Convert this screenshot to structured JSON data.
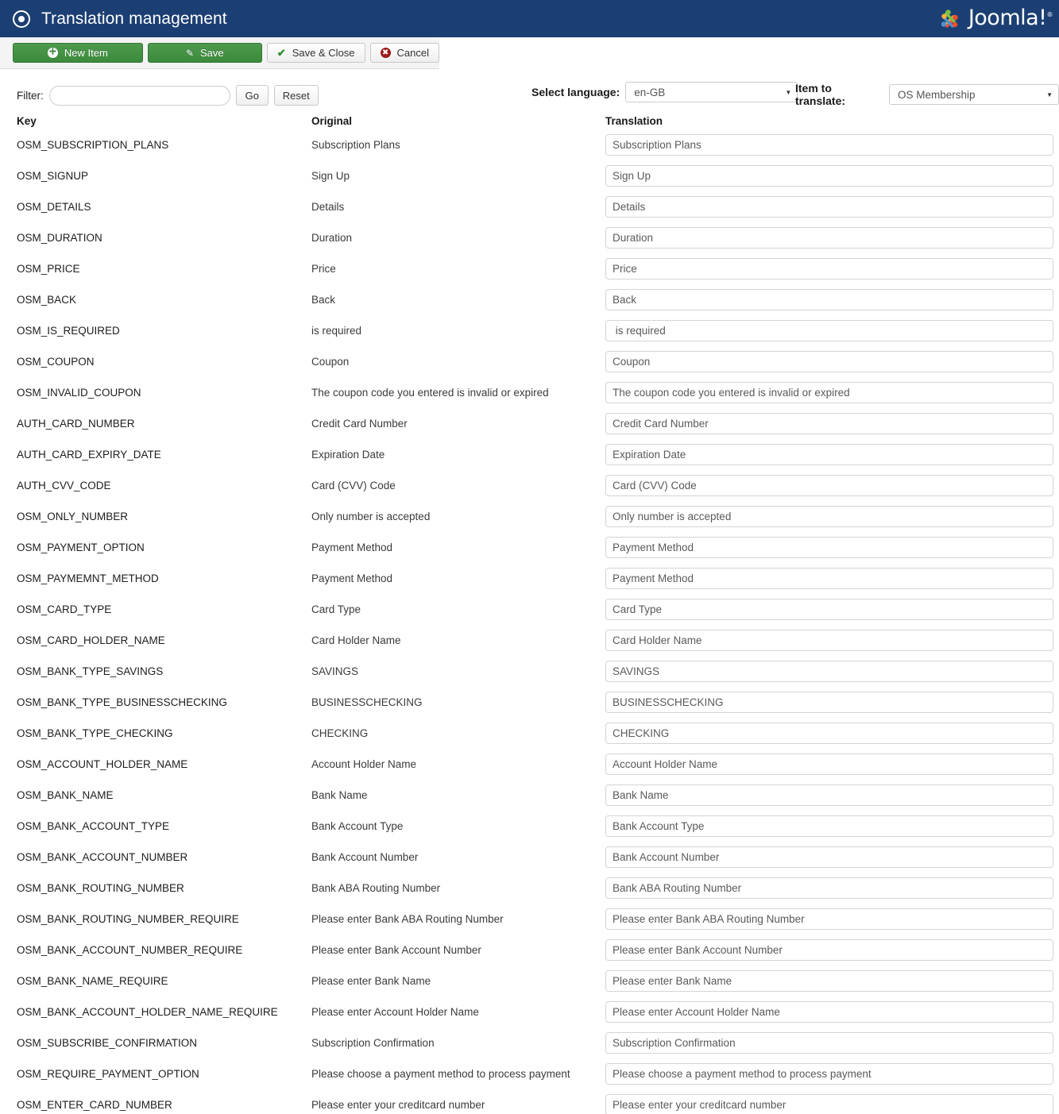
{
  "header": {
    "title": "Translation management",
    "icon": "target-icon",
    "logo_text": "Joomla!",
    "logo_tm": "®",
    "bg_color": "#1c3f73"
  },
  "toolbar": {
    "new_item_label": "New Item",
    "save_label": "Save",
    "save_close_label": "Save & Close",
    "cancel_label": "Cancel",
    "green_color": "#3c8a3c"
  },
  "filter": {
    "label": "Filter:",
    "value": "",
    "placeholder": "",
    "go_label": "Go",
    "reset_label": "Reset"
  },
  "selectors": {
    "language_label": "Select language:",
    "language_value": "en-GB",
    "item_label": "Item to translate:",
    "item_value": "OS Membership"
  },
  "table": {
    "columns": [
      "Key",
      "Original",
      "Translation"
    ],
    "rows": [
      {
        "key": "OSM_SUBSCRIPTION_PLANS",
        "original": "Subscription Plans",
        "translation": "Subscription Plans"
      },
      {
        "key": "OSM_SIGNUP",
        "original": "Sign Up",
        "translation": "Sign Up"
      },
      {
        "key": "OSM_DETAILS",
        "original": "Details",
        "translation": "Details"
      },
      {
        "key": "OSM_DURATION",
        "original": "Duration",
        "translation": "Duration"
      },
      {
        "key": "OSM_PRICE",
        "original": "Price",
        "translation": "Price"
      },
      {
        "key": "OSM_BACK",
        "original": "Back",
        "translation": "Back"
      },
      {
        "key": "OSM_IS_REQUIRED",
        "original": "is required",
        "translation": " is required"
      },
      {
        "key": "OSM_COUPON",
        "original": "Coupon",
        "translation": "Coupon"
      },
      {
        "key": "OSM_INVALID_COUPON",
        "original": "The coupon code you entered is invalid or expired",
        "translation": "The coupon code you entered is invalid or expired"
      },
      {
        "key": "AUTH_CARD_NUMBER",
        "original": "Credit Card Number",
        "translation": "Credit Card Number"
      },
      {
        "key": "AUTH_CARD_EXPIRY_DATE",
        "original": "Expiration Date",
        "translation": "Expiration Date"
      },
      {
        "key": "AUTH_CVV_CODE",
        "original": "Card (CVV) Code",
        "translation": "Card (CVV) Code"
      },
      {
        "key": "OSM_ONLY_NUMBER",
        "original": "Only number is accepted",
        "translation": "Only number is accepted"
      },
      {
        "key": "OSM_PAYMENT_OPTION",
        "original": "Payment Method",
        "translation": "Payment Method"
      },
      {
        "key": "OSM_PAYMEMNT_METHOD",
        "original": "Payment Method",
        "translation": "Payment Method"
      },
      {
        "key": "OSM_CARD_TYPE",
        "original": "Card Type",
        "translation": "Card Type"
      },
      {
        "key": "OSM_CARD_HOLDER_NAME",
        "original": "Card Holder Name",
        "translation": "Card Holder Name"
      },
      {
        "key": "OSM_BANK_TYPE_SAVINGS",
        "original": "SAVINGS",
        "translation": "SAVINGS"
      },
      {
        "key": "OSM_BANK_TYPE_BUSINESSCHECKING",
        "original": "BUSINESSCHECKING",
        "translation": "BUSINESSCHECKING"
      },
      {
        "key": "OSM_BANK_TYPE_CHECKING",
        "original": "CHECKING",
        "translation": "CHECKING"
      },
      {
        "key": "OSM_ACCOUNT_HOLDER_NAME",
        "original": "Account Holder Name",
        "translation": "Account Holder Name"
      },
      {
        "key": "OSM_BANK_NAME",
        "original": "Bank Name",
        "translation": "Bank Name"
      },
      {
        "key": "OSM_BANK_ACCOUNT_TYPE",
        "original": "Bank Account Type",
        "translation": "Bank Account Type"
      },
      {
        "key": "OSM_BANK_ACCOUNT_NUMBER",
        "original": "Bank Account Number",
        "translation": "Bank Account Number"
      },
      {
        "key": "OSM_BANK_ROUTING_NUMBER",
        "original": "Bank ABA Routing Number",
        "translation": "Bank ABA Routing Number"
      },
      {
        "key": "OSM_BANK_ROUTING_NUMBER_REQUIRE",
        "original": "Please enter Bank ABA Routing Number",
        "translation": "Please enter Bank ABA Routing Number"
      },
      {
        "key": "OSM_BANK_ACCOUNT_NUMBER_REQUIRE",
        "original": "Please enter Bank Account Number",
        "translation": "Please enter Bank Account Number"
      },
      {
        "key": "OSM_BANK_NAME_REQUIRE",
        "original": "Please enter Bank Name",
        "translation": "Please enter Bank Name"
      },
      {
        "key": "OSM_BANK_ACCOUNT_HOLDER_NAME_REQUIRE",
        "original": "Please enter Account Holder Name",
        "translation": "Please enter Account Holder Name"
      },
      {
        "key": "OSM_SUBSCRIBE_CONFIRMATION",
        "original": "Subscription Confirmation",
        "translation": "Subscription Confirmation"
      },
      {
        "key": "OSM_REQUIRE_PAYMENT_OPTION",
        "original": "Please choose a payment method to process payment",
        "translation": "Please choose a payment method to process payment"
      },
      {
        "key": "OSM_ENTER_CARD_NUMBER",
        "original": "Please enter your creditcard number",
        "translation": "Please enter your creditcard number"
      }
    ]
  }
}
